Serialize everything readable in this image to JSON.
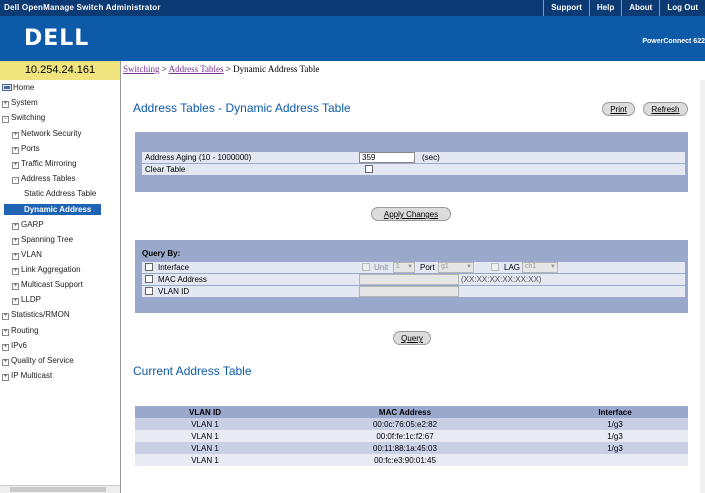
{
  "topbar": {
    "title": "Dell OpenManage Switch Administrator",
    "links": [
      "Support",
      "Help",
      "About",
      "Log Out"
    ]
  },
  "banner": {
    "logo": "DELL",
    "product": "PowerConnect 622"
  },
  "ip": "10.254.24.161",
  "breadcrumb": {
    "item1": "Switching",
    "sep": " > ",
    "item2": "Address Tables",
    "current": " > Dynamic Address Table"
  },
  "sidebar": {
    "items": [
      {
        "label": "Home",
        "icon": "home-icon"
      },
      {
        "label": "System",
        "pm": "+"
      },
      {
        "label": "Switching",
        "pm": "-"
      },
      {
        "label": "Network Security",
        "pm": "+"
      },
      {
        "label": "Ports",
        "pm": "+"
      },
      {
        "label": "Traffic Mirroring",
        "pm": "+"
      },
      {
        "label": "Address Tables",
        "pm": "-"
      },
      {
        "label": "Static Address Table"
      },
      {
        "label": "Dynamic Address"
      },
      {
        "label": "GARP",
        "pm": "+"
      },
      {
        "label": "Spanning Tree",
        "pm": "+"
      },
      {
        "label": "VLAN",
        "pm": "+"
      },
      {
        "label": "Link Aggregation",
        "pm": "+"
      },
      {
        "label": "Multicast Support",
        "pm": "+"
      },
      {
        "label": "LLDP",
        "pm": "+"
      },
      {
        "label": "Statistics/RMON",
        "pm": "+"
      },
      {
        "label": "Routing",
        "pm": "+"
      },
      {
        "label": "IPv6",
        "pm": "+"
      },
      {
        "label": "Quality of Service",
        "pm": "+"
      },
      {
        "label": "IP Multicast",
        "pm": "+"
      }
    ]
  },
  "page": {
    "title": "Address Tables - Dynamic Address Table",
    "print": "Print",
    "refresh": "Refresh"
  },
  "settings": {
    "aging_label": "Address Aging (10 - 1000000)",
    "aging_value": "359",
    "aging_unit": "(sec)",
    "clear_label": "Clear Table",
    "apply": "Apply Changes"
  },
  "query": {
    "heading": "Query By:",
    "interface_label": "Interface",
    "unit_label": "Unit",
    "unit_value": "1",
    "port_label": "Port",
    "port_value": "g1",
    "lag_label": "LAG",
    "lag_value": "ch1",
    "mac_label": "MAC Address",
    "mac_hint": "(XX:XX:XX:XX:XX:XX)",
    "vlan_label": "VLAN ID",
    "button": "Query"
  },
  "table": {
    "title": "Current Address Table",
    "headers": [
      "VLAN ID",
      "MAC Address",
      "Interface"
    ],
    "rows": [
      [
        "VLAN 1",
        "00:0c:76:05:e2:82",
        "1/g3"
      ],
      [
        "VLAN 1",
        "00:0f:fe:1c:f2:67",
        "1/g3"
      ],
      [
        "VLAN 1",
        "00:11:88:1a:45:03",
        "1/g3"
      ],
      [
        "VLAN 1",
        "00:fc:e3:90:01:45",
        ""
      ]
    ]
  },
  "colors": {
    "topbar": "#0c3a74",
    "banner": "#0d5ba8",
    "accent": "#0d5ba8",
    "panel": "#9aa8cc",
    "selected": "#1f63b4",
    "ipbox": "#f0e47e"
  }
}
